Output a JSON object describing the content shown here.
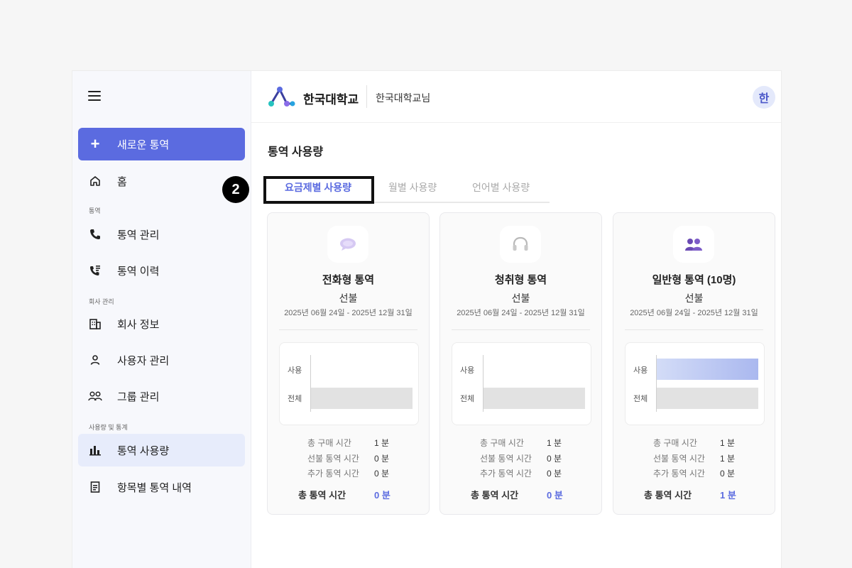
{
  "sidebar": {
    "new_button": "새로운 통역",
    "home": "홈",
    "section_interp": "통역",
    "interp_manage": "통역 관리",
    "interp_history": "통역 이력",
    "section_company": "회사 관리",
    "company_info": "회사 정보",
    "user_manage": "사용자 관리",
    "group_manage": "그룹 관리",
    "section_usage": "사용량 및 통계",
    "usage": "통역 사용량",
    "item_history": "항목별 통역 내역"
  },
  "header": {
    "brand": "한국대학교",
    "user_name": "한국대학교님",
    "avatar": "한"
  },
  "main": {
    "title": "통역 사용량",
    "tabs": [
      "요금제별 사용량",
      "월별 사용량",
      "언어별 사용량"
    ],
    "step_badge": "2"
  },
  "chart_labels": {
    "used": "사용",
    "total": "전체"
  },
  "stat_labels": {
    "purchased": "총 구매 시간",
    "prepaid": "선불 통역 시간",
    "extra": "추가 통역 시간",
    "total": "총 통역 시간"
  },
  "colors": {
    "accent": "#5b6be0",
    "active_nav_bg": "#e7ecfb"
  },
  "cards": [
    {
      "icon": "speech-bubble-icon",
      "title": "전화형 통역",
      "plan_type": "선불",
      "period": "2025년 06월 24일 - 2025년 12월 31일",
      "usage_fraction": 0,
      "purchased": "1 분",
      "prepaid": "0 분",
      "extra": "0 분",
      "total": "0 분"
    },
    {
      "icon": "headphones-icon",
      "title": "청취형 통역",
      "plan_type": "선불",
      "period": "2025년 06월 24일 - 2025년 12월 31일",
      "usage_fraction": 0,
      "purchased": "1 분",
      "prepaid": "0 분",
      "extra": "0 분",
      "total": "0 분"
    },
    {
      "icon": "group-people-icon",
      "title": "일반형 통역 (10명)",
      "plan_type": "선불",
      "period": "2025년 06월 24일 - 2025년 12월 31일",
      "usage_fraction": 1,
      "purchased": "1 분",
      "prepaid": "1 분",
      "extra": "0 분",
      "total": "1 분"
    }
  ]
}
